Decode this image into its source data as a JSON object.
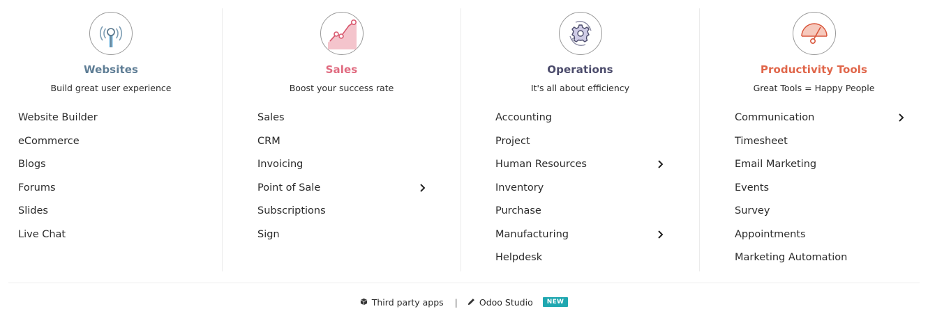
{
  "colors": {
    "websites": "#5e7d95",
    "sales": "#e06a7f",
    "operations": "#4b4b6b",
    "productivity": "#e0664a",
    "badge": "#1fa7b0"
  },
  "categories": [
    {
      "title": "Websites",
      "subtitle": "Build great user experience",
      "icon": "antenna-icon",
      "items": [
        {
          "label": "Website Builder"
        },
        {
          "label": "eCommerce"
        },
        {
          "label": "Blogs"
        },
        {
          "label": "Forums"
        },
        {
          "label": "Slides"
        },
        {
          "label": "Live Chat"
        }
      ]
    },
    {
      "title": "Sales",
      "subtitle": "Boost your success rate",
      "icon": "sales-chart-icon",
      "items": [
        {
          "label": "Sales"
        },
        {
          "label": "CRM"
        },
        {
          "label": "Invoicing"
        },
        {
          "label": "Point of Sale",
          "submenu": true
        },
        {
          "label": "Subscriptions"
        },
        {
          "label": "Sign"
        }
      ]
    },
    {
      "title": "Operations",
      "subtitle": "It's all about efficiency",
      "icon": "gear-icon",
      "items": [
        {
          "label": "Accounting"
        },
        {
          "label": "Project"
        },
        {
          "label": "Human Resources",
          "submenu": true
        },
        {
          "label": "Inventory"
        },
        {
          "label": "Purchase"
        },
        {
          "label": "Manufacturing",
          "submenu": true
        },
        {
          "label": "Helpdesk"
        }
      ]
    },
    {
      "title": "Productivity Tools",
      "subtitle": "Great Tools = Happy People",
      "icon": "gauge-icon",
      "items": [
        {
          "label": "Communication",
          "submenu": true
        },
        {
          "label": "Timesheet"
        },
        {
          "label": "Email Marketing"
        },
        {
          "label": "Events"
        },
        {
          "label": "Survey"
        },
        {
          "label": "Appointments"
        },
        {
          "label": "Marketing Automation"
        }
      ]
    }
  ],
  "footer": {
    "third_party_label": "Third party apps",
    "third_party_icon": "cube-icon",
    "separator": "|",
    "studio_label": "Odoo Studio",
    "studio_icon": "pencil-icon",
    "badge": "NEW"
  }
}
